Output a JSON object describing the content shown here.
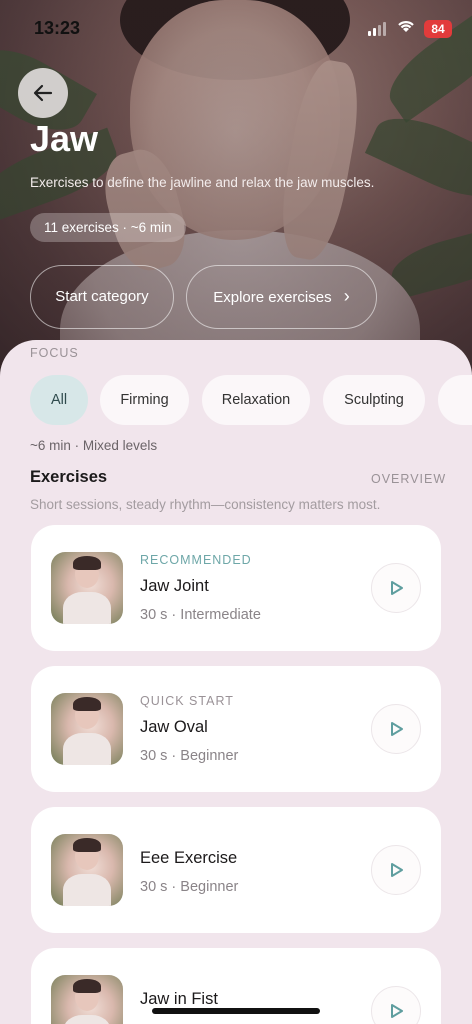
{
  "status": {
    "time": "13:23",
    "battery": "84"
  },
  "header": {
    "title": "Jaw",
    "description": "Exercises to define the jawline and relax the jaw muscles.",
    "count_label": "11 exercises · ~6 min",
    "start_label": "Start category",
    "explore_label": "Explore exercises",
    "explore_chevron": "›"
  },
  "focus": {
    "label": "FOCUS",
    "chips": [
      {
        "label": "All",
        "active": true
      },
      {
        "label": "Firming",
        "active": false
      },
      {
        "label": "Relaxation",
        "active": false
      },
      {
        "label": "Sculpting",
        "active": false
      }
    ],
    "meta": "~6 min · Mixed levels"
  },
  "exercises": {
    "title": "Exercises",
    "overview_label": "OVERVIEW",
    "subtitle": "Short sessions, steady rhythm—consistency matters most.",
    "items": [
      {
        "tag": "RECOMMENDED",
        "name": "Jaw Joint",
        "meta": "30 s · Intermediate"
      },
      {
        "tag": "QUICK START",
        "name": "Jaw Oval",
        "meta": "30 s · Beginner"
      },
      {
        "tag": "",
        "name": "Eee Exercise",
        "meta": "30 s · Beginner"
      },
      {
        "tag": "",
        "name": "Jaw in Fist",
        "meta": ""
      }
    ]
  },
  "colors": {
    "accent_teal": "#6ea7a8",
    "active_chip": "#d7e7e8",
    "sheet_bg": "#f1e5ec"
  }
}
